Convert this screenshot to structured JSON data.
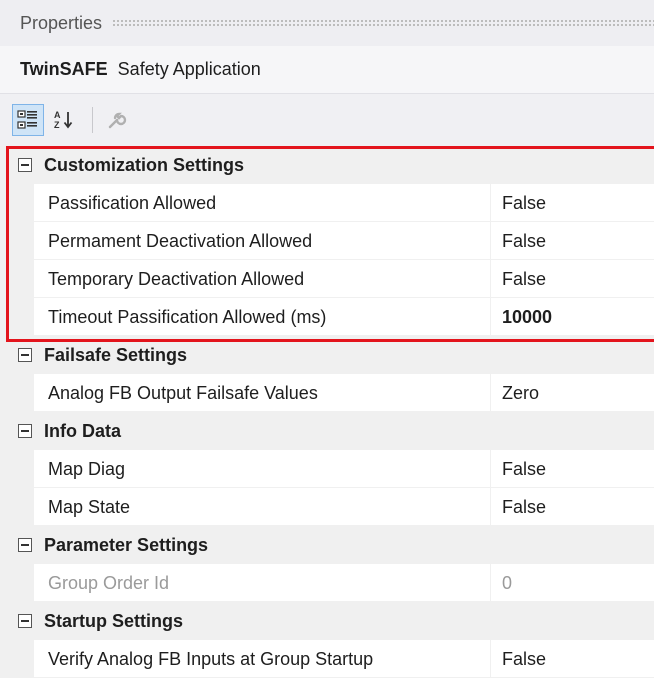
{
  "panel": {
    "title": "Properties"
  },
  "object": {
    "name": "TwinSAFE",
    "type": "Safety Application"
  },
  "toolbar": {
    "categorized_icon": "categorized-icon",
    "alphabetical_icon": "alphabetical-icon",
    "property_pages_icon": "wrench-icon"
  },
  "highlight_color": "#e3141c",
  "categories": [
    {
      "label": "Customization Settings",
      "props": [
        {
          "name": "Passification Allowed",
          "value": "False"
        },
        {
          "name": "Permament Deactivation Allowed",
          "value": "False"
        },
        {
          "name": "Temporary Deactivation Allowed",
          "value": "False"
        },
        {
          "name": "Timeout Passification Allowed (ms)",
          "value": "10000"
        }
      ]
    },
    {
      "label": "Failsafe Settings",
      "props": [
        {
          "name": "Analog FB Output Failsafe Values",
          "value": "Zero"
        }
      ]
    },
    {
      "label": "Info Data",
      "props": [
        {
          "name": "Map Diag",
          "value": "False"
        },
        {
          "name": "Map State",
          "value": "False"
        }
      ]
    },
    {
      "label": "Parameter Settings",
      "props": [
        {
          "name": "Group Order Id",
          "value": "0"
        }
      ]
    },
    {
      "label": "Startup Settings",
      "props": [
        {
          "name": "Verify Analog FB Inputs at Group Startup",
          "value": "False"
        }
      ]
    }
  ]
}
